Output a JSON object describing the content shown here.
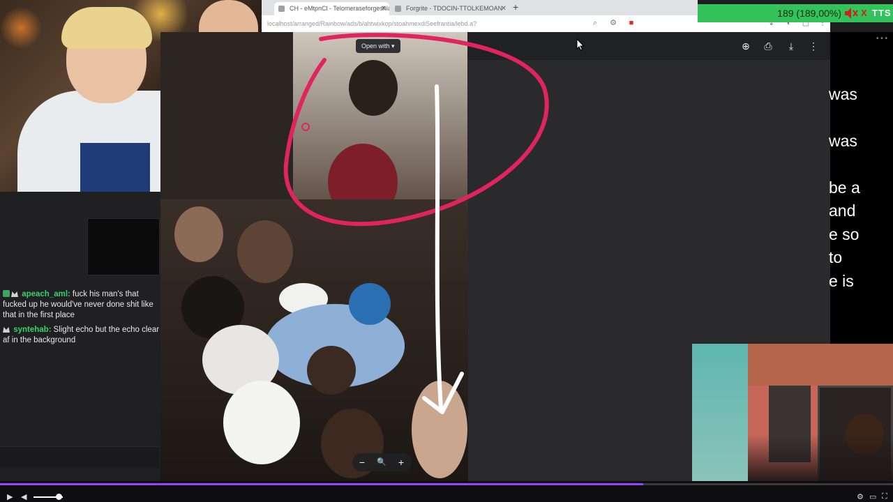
{
  "browser": {
    "tabs": [
      {
        "label": "CH - eMtpnCl - Telomeraseforgeshlaw",
        "active": true
      },
      {
        "label": "Forgrite - TDOCIN-TTOLKEMOAN",
        "active": false
      }
    ],
    "new_tab": "+",
    "url": "localhost/arranged/Rainbow/ads/b/ahtwixkop/stoahmexdiSeefrantia/lebd.a?"
  },
  "viewer": {
    "open_with_label": "Open with",
    "toolbar_icons": [
      "add-to-drive-icon",
      "print-icon",
      "download-icon",
      "more-icon"
    ],
    "zoom": {
      "minus": "−",
      "zoom_icon": "🔍",
      "plus": "+"
    }
  },
  "tts": {
    "count_text": "189 (189,00%)",
    "close": "X",
    "label": "TTS"
  },
  "caption_lines": [
    "was",
    "was",
    "be a",
    "and",
    "e so",
    "to",
    "e is"
  ],
  "chat": {
    "messages": [
      {
        "user": "apeach_aml:",
        "text": "fuck his man's that fucked up he would've never done shit like that in the first place",
        "badges": [
          "sub",
          "crown"
        ]
      },
      {
        "user": "syntehab:",
        "text": "Slight echo but the echo clear af in the background",
        "badges": [
          "crown"
        ]
      }
    ]
  },
  "player": {
    "progress_fraction": 0.72,
    "volume_fraction": 0.85
  },
  "colors": {
    "accent_progress": "#9147ff",
    "tts_green": "#34c25a",
    "chat_username": "#34d26b",
    "annotation_pink": "#e0245e"
  }
}
